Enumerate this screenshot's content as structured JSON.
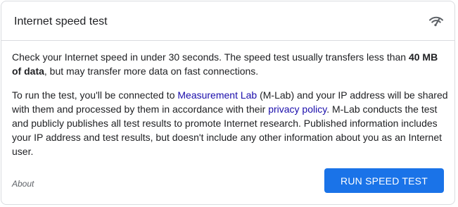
{
  "header": {
    "title": "Internet speed test",
    "icon": "wifi-speed-icon"
  },
  "body": {
    "paragraph1": {
      "text_before": "Check your Internet speed in under 30 seconds. The speed test usually transfers less than ",
      "bold": "40 MB of data",
      "text_after": ", but may transfer more data on fast connections."
    },
    "paragraph2": {
      "text1": "To run the test, you'll be connected to ",
      "link1": "Measurement Lab",
      "text2": " (M-Lab) and your IP address will be shared with them and processed by them in accordance with their ",
      "link2": "privacy policy",
      "text3": ". M-Lab conducts the test and publicly publishes all test results to promote Internet research. Published information includes your IP address and test results, but doesn't include any other information about you as an Internet user."
    }
  },
  "footer": {
    "about_label": "About",
    "run_button_label": "RUN SPEED TEST"
  },
  "colors": {
    "accent": "#1a73e8",
    "link": "#1a0dab",
    "text": "#202124",
    "muted": "#5f6368",
    "border": "#dadce0"
  }
}
